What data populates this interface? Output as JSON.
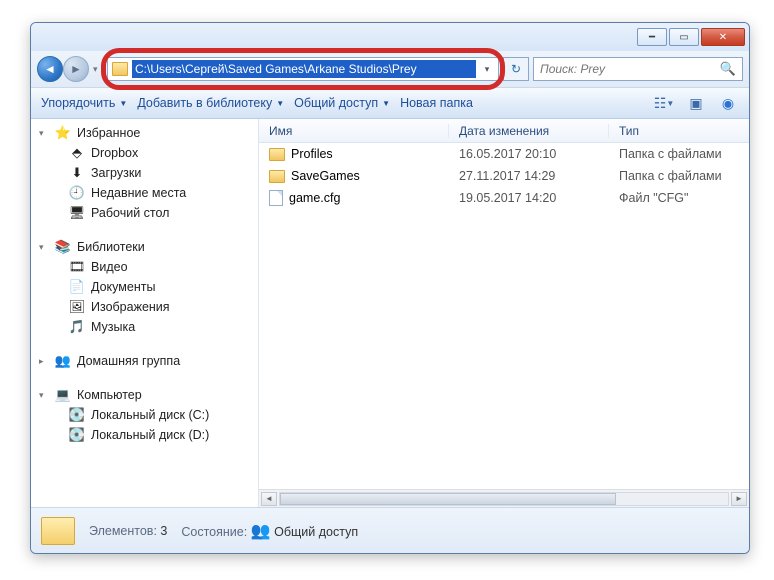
{
  "address": {
    "path": "C:\\Users\\Сергей\\Saved Games\\Arkane Studios\\Prey"
  },
  "search": {
    "placeholder": "Поиск: Prey"
  },
  "toolbar": {
    "organize": "Упорядочить",
    "addlib": "Добавить в библиотеку",
    "share": "Общий доступ",
    "newfolder": "Новая папка"
  },
  "columns": {
    "name": "Имя",
    "date": "Дата изменения",
    "type": "Тип"
  },
  "sidebar": {
    "favorites": {
      "label": "Избранное",
      "items": [
        "Dropbox",
        "Загрузки",
        "Недавние места",
        "Рабочий стол"
      ]
    },
    "libraries": {
      "label": "Библиотеки",
      "items": [
        "Видео",
        "Документы",
        "Изображения",
        "Музыка"
      ]
    },
    "homegroup": {
      "label": "Домашняя группа"
    },
    "computer": {
      "label": "Компьютер",
      "items": [
        "Локальный диск (C:)",
        "Локальный диск (D:)"
      ]
    }
  },
  "files": [
    {
      "name": "Profiles",
      "date": "16.05.2017 20:10",
      "type": "Папка с файлами",
      "kind": "folder"
    },
    {
      "name": "SaveGames",
      "date": "27.11.2017 14:29",
      "type": "Папка с файлами",
      "kind": "folder"
    },
    {
      "name": "game.cfg",
      "date": "19.05.2017 14:20",
      "type": "Файл \"CFG\"",
      "kind": "file"
    }
  ],
  "status": {
    "elements_label": "Элементов:",
    "elements_count": "3",
    "state_label": "Состояние:",
    "state_value": "Общий доступ"
  }
}
